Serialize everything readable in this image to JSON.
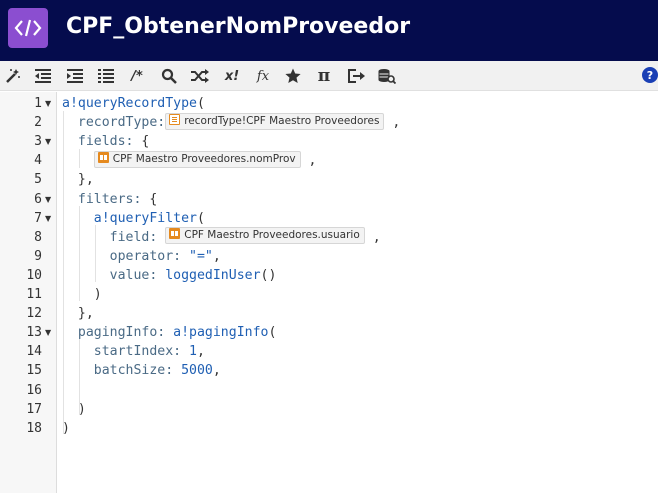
{
  "header": {
    "title": "CPF_ObtenerNomProveedor",
    "logo_icon": "code-brackets-icon",
    "background": "#050c4d",
    "logo_color": "#8b4ed0"
  },
  "toolbar": {
    "items": [
      {
        "name": "magic-wand-icon"
      },
      {
        "name": "outdent-icon"
      },
      {
        "name": "indent-icon"
      },
      {
        "name": "format-list-icon"
      },
      {
        "name": "comment-icon",
        "label": "/*"
      },
      {
        "name": "search-icon"
      },
      {
        "name": "shuffle-icon"
      },
      {
        "name": "x-bang-icon",
        "label": "x!"
      },
      {
        "name": "function-icon",
        "label": "fx"
      },
      {
        "name": "star-icon"
      },
      {
        "name": "pi-icon",
        "label": "π"
      },
      {
        "name": "export-icon"
      },
      {
        "name": "database-search-icon"
      },
      {
        "name": "help-icon",
        "label": "?"
      }
    ]
  },
  "editor": {
    "line_numbers": [
      "1",
      "2",
      "3",
      "4",
      "5",
      "6",
      "7",
      "8",
      "9",
      "10",
      "11",
      "12",
      "13",
      "14",
      "15",
      "16",
      "17",
      "18"
    ],
    "fold_markers": [
      "▼",
      "",
      "▼",
      "",
      "",
      "▼",
      "▼",
      "",
      "",
      "",
      "",
      "",
      "▼",
      "",
      "",
      "",
      "",
      ""
    ],
    "lines": [
      [
        {
          "t": "fn",
          "v": "a!queryRecordType"
        },
        {
          "t": "pun",
          "v": "("
        }
      ],
      [
        {
          "t": "key",
          "v": "  recordType:"
        },
        {
          "t": "token",
          "icon": "rt",
          "v": "recordType!CPF Maestro Proveedores"
        },
        {
          "t": "pun",
          "v": " ,"
        }
      ],
      [
        {
          "t": "key",
          "v": "  fields:"
        },
        {
          "t": "pun",
          "v": " {"
        }
      ],
      [
        {
          "t": "pun",
          "v": "    "
        },
        {
          "t": "token",
          "icon": "fld",
          "v": "CPF Maestro Proveedores.nomProv"
        },
        {
          "t": "pun",
          "v": " ,"
        }
      ],
      [
        {
          "t": "pun",
          "v": "  },"
        }
      ],
      [
        {
          "t": "key",
          "v": "  filters:"
        },
        {
          "t": "pun",
          "v": " {"
        }
      ],
      [
        {
          "t": "fn",
          "v": "    a!queryFilter"
        },
        {
          "t": "pun",
          "v": "("
        }
      ],
      [
        {
          "t": "key",
          "v": "      field:"
        },
        {
          "t": "pun",
          "v": " "
        },
        {
          "t": "token",
          "icon": "fld",
          "v": "CPF Maestro Proveedores.usuario"
        },
        {
          "t": "pun",
          "v": " ,"
        }
      ],
      [
        {
          "t": "key",
          "v": "      operator:"
        },
        {
          "t": "pun",
          "v": " "
        },
        {
          "t": "str",
          "v": "\"=\""
        },
        {
          "t": "pun",
          "v": ","
        }
      ],
      [
        {
          "t": "key",
          "v": "      value:"
        },
        {
          "t": "pun",
          "v": " "
        },
        {
          "t": "fn",
          "v": "loggedInUser"
        },
        {
          "t": "pun",
          "v": "()"
        }
      ],
      [
        {
          "t": "pun",
          "v": "    )"
        }
      ],
      [
        {
          "t": "pun",
          "v": "  },"
        }
      ],
      [
        {
          "t": "key",
          "v": "  pagingInfo:"
        },
        {
          "t": "pun",
          "v": " "
        },
        {
          "t": "fn",
          "v": "a!pagingInfo"
        },
        {
          "t": "pun",
          "v": "("
        }
      ],
      [
        {
          "t": "key",
          "v": "    startIndex:"
        },
        {
          "t": "pun",
          "v": " "
        },
        {
          "t": "num",
          "v": "1"
        },
        {
          "t": "pun",
          "v": ","
        }
      ],
      [
        {
          "t": "key",
          "v": "    batchSize:"
        },
        {
          "t": "pun",
          "v": " "
        },
        {
          "t": "num",
          "v": "5000"
        },
        {
          "t": "pun",
          "v": ","
        }
      ],
      [
        {
          "t": "pun",
          "v": ""
        }
      ],
      [
        {
          "t": "pun",
          "v": "  )"
        }
      ],
      [
        {
          "t": "pun",
          "v": ")"
        }
      ]
    ]
  }
}
